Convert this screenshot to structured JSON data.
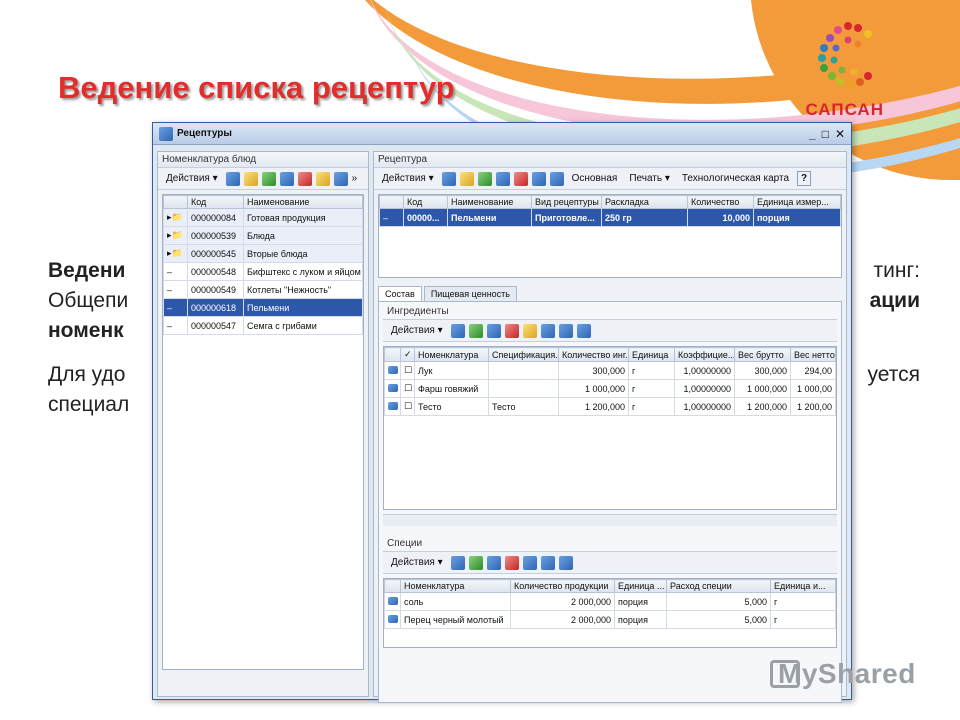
{
  "slide": {
    "title": "Ведение списка рецептур",
    "logo_text": "САПСАН",
    "line1_left": "Ведени",
    "line1_right": "тинг:",
    "line2_left": "Общепи",
    "line2_right": "ации",
    "line3_left": "номенк",
    "line4_left": "Для удо",
    "line4_right": "уется",
    "line5_left": "специал",
    "watermark": "MyShared"
  },
  "window": {
    "title": "Рецептуры",
    "left_pane": {
      "header": "Номенклатура блюд",
      "actions": "Действия ▾",
      "columns": [
        "Код",
        "Наименование"
      ],
      "rows": [
        {
          "code": "000000084",
          "name": "Готовая продукция"
        },
        {
          "code": "000000539",
          "name": "Блюда"
        },
        {
          "code": "000000545",
          "name": "Вторые блюда"
        },
        {
          "code": "000000548",
          "name": "Бифштекс с луком и яйцом"
        },
        {
          "code": "000000549",
          "name": "Котлеты \"Нежность\""
        },
        {
          "code": "000000618",
          "name": "Пельмени"
        },
        {
          "code": "000000547",
          "name": "Семга с грибами"
        }
      ]
    },
    "right_pane": {
      "header": "Рецептура",
      "actions": "Действия ▾",
      "btn_main": "Основная",
      "btn_print": "Печать ▾",
      "btn_tech": "Технологическая карта",
      "columns": [
        "Код",
        "Наименование",
        "Вид рецептуры",
        "Раскладка",
        "Количество",
        "Единица измер..."
      ],
      "row": {
        "code": "00000...",
        "name": "Пельмени",
        "type": "Приготовле...",
        "layout": "250 гр",
        "qty": "10,000",
        "unit": "порция"
      },
      "tabs": [
        "Состав",
        "Пищевая ценность"
      ],
      "ingredients": {
        "title": "Ингредиенты",
        "actions": "Действия ▾",
        "columns": [
          "Номенклатура",
          "Спецификация...",
          "Количество инг...",
          "Единица",
          "Коэффицие...",
          "Вес брутто",
          "Вес нетто"
        ],
        "rows": [
          {
            "name": "Лук",
            "spec": "",
            "qty": "300,000",
            "unit": "г",
            "coef": "1,00000000",
            "gross": "300,000",
            "net": "294,00"
          },
          {
            "name": "Фарш говяжий",
            "spec": "",
            "qty": "1 000,000",
            "unit": "г",
            "coef": "1,00000000",
            "gross": "1 000,000",
            "net": "1 000,00"
          },
          {
            "name": "Тесто",
            "spec": "Тесто",
            "qty": "1 200,000",
            "unit": "г",
            "coef": "1,00000000",
            "gross": "1 200,000",
            "net": "1 200,00"
          }
        ]
      },
      "spices": {
        "title": "Специи",
        "actions": "Действия ▾",
        "columns": [
          "Номенклатура",
          "Количество продукции",
          "Единица ...",
          "Расход специи",
          "Единица и..."
        ],
        "rows": [
          {
            "name": "соль",
            "qty": "2 000,000",
            "unit": "порция",
            "usage": "5,000",
            "unit2": "г"
          },
          {
            "name": "Перец черный молотый",
            "qty": "2 000,000",
            "unit": "порция",
            "usage": "5,000",
            "unit2": "г"
          }
        ]
      }
    }
  }
}
